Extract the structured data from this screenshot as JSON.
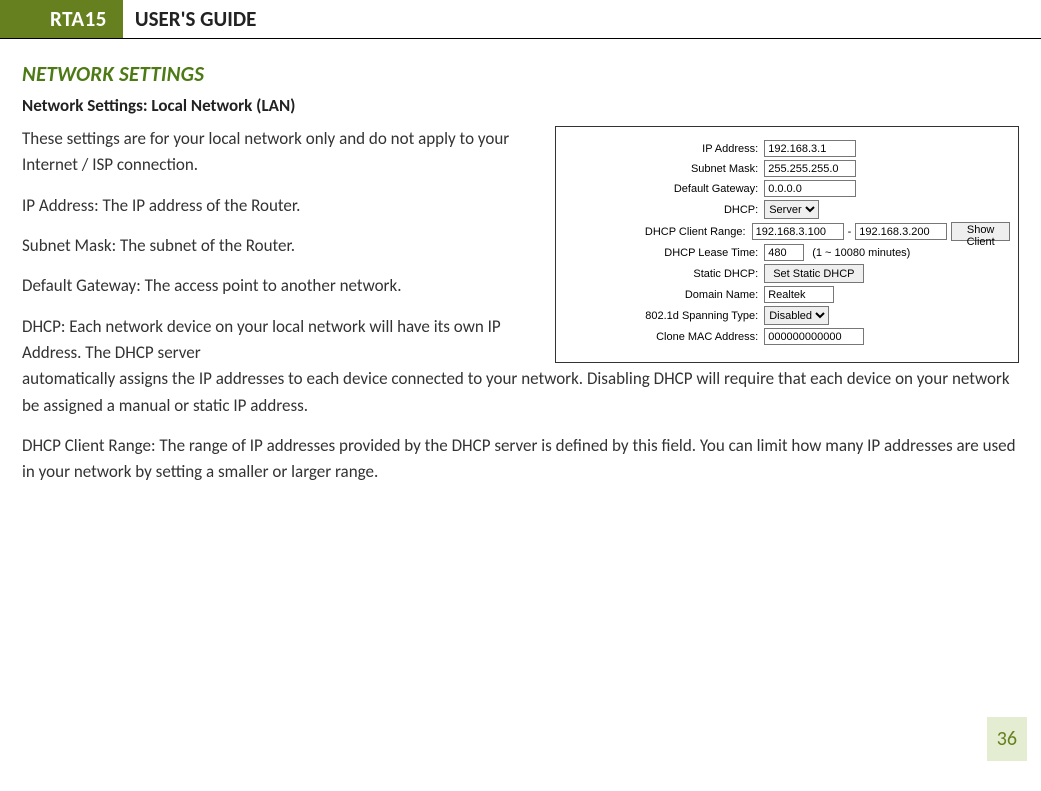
{
  "header": {
    "brand": "RTA15",
    "title": "USER'S GUIDE"
  },
  "section": {
    "heading": "NETWORK SETTINGS",
    "subheading": "Network Settings: Local Network (LAN)"
  },
  "body": {
    "intro1": "These settings are for your local network only and do not apply to your Internet / ISP connection.",
    "ip_para": "IP Address: The IP address of the Router.",
    "subnet_para": "Subnet Mask: The subnet of the Router.",
    "gateway_para": "Default Gateway: The access point to another network.",
    "dhcp_para_a": "DHCP: Each network device on your local network will have its own IP Address.  The DHCP server",
    "dhcp_para_b": "automatically assigns the IP addresses to each device connected to your network.  Disabling DHCP will require that each device on your network be assigned a manual or static IP address.",
    "range_para": "DHCP Client Range: The range of IP addresses provided by the DHCP server is defined by this field.  You can limit how many IP addresses are used in your network by setting a smaller or larger range."
  },
  "panel": {
    "labels": {
      "ip": "IP Address:",
      "subnet": "Subnet Mask:",
      "gateway": "Default Gateway:",
      "dhcp": "DHCP:",
      "range": "DHCP Client Range:",
      "lease": "DHCP Lease Time:",
      "static": "Static DHCP:",
      "domain": "Domain Name:",
      "spanning": "802.1d Spanning Type:",
      "clone": "Clone MAC Address:"
    },
    "values": {
      "ip": "192.168.3.1",
      "subnet": "255.255.255.0",
      "gateway": "0.0.0.0",
      "dhcp_select": "Server",
      "range_start": "192.168.3.100",
      "range_sep": "-",
      "range_end": "192.168.3.200",
      "show_client_btn": "Show Client",
      "lease": "480",
      "lease_hint": "(1 ~ 10080 minutes)",
      "static_btn": "Set Static DHCP",
      "domain": "Realtek",
      "spanning_select": "Disabled",
      "clone": "000000000000"
    }
  },
  "page_number": "36"
}
